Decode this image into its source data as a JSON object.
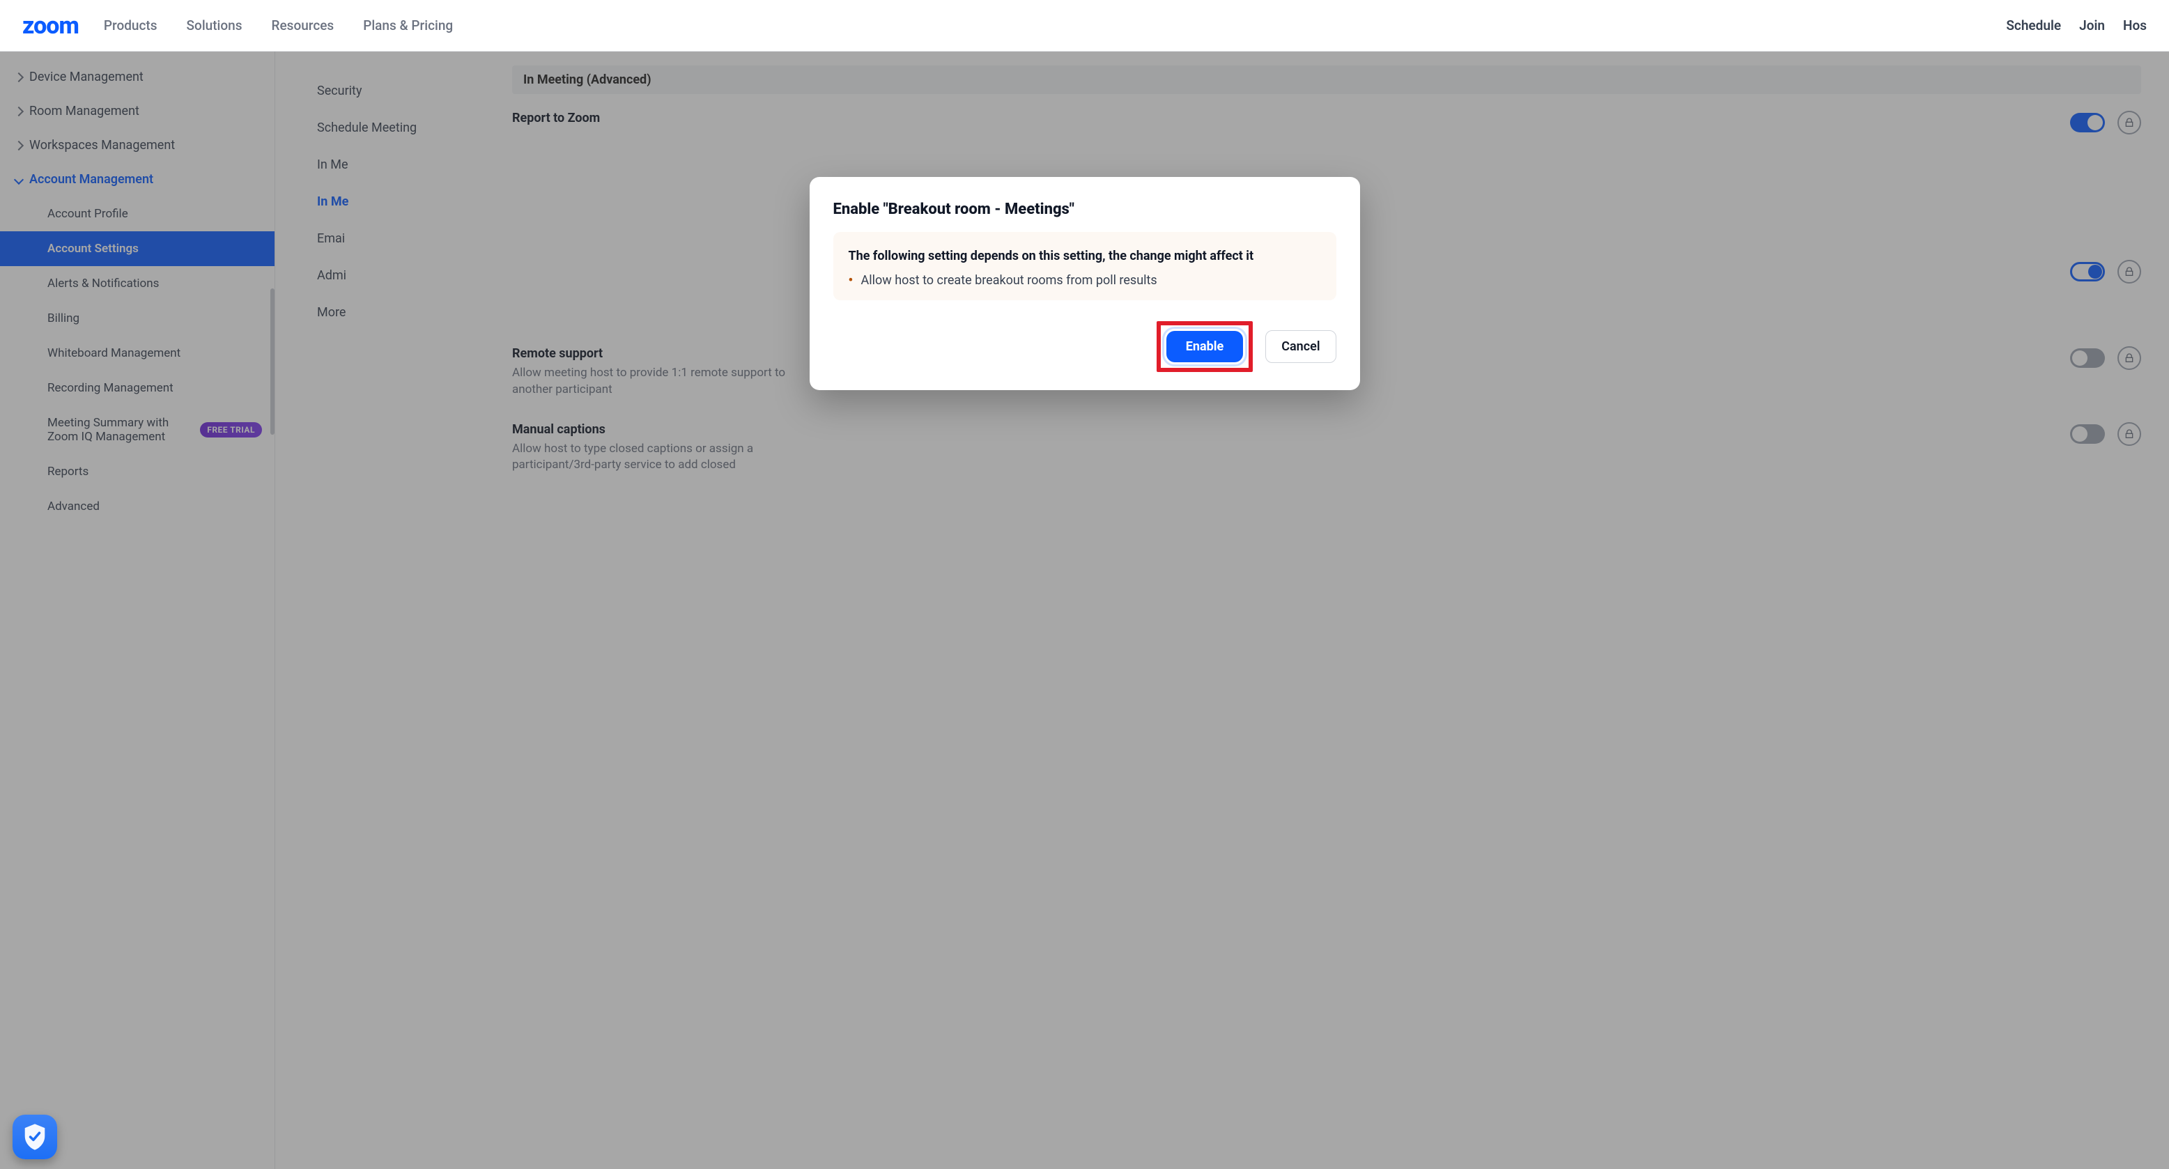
{
  "topnav": {
    "logo": "zoom",
    "menu": [
      "Products",
      "Solutions",
      "Resources",
      "Plans & Pricing"
    ],
    "right": [
      "Schedule",
      "Join",
      "Hos"
    ]
  },
  "sidebar": {
    "items": [
      {
        "label": "Device Management",
        "expanded": false
      },
      {
        "label": "Room Management",
        "expanded": false
      },
      {
        "label": "Workspaces Management",
        "expanded": false
      },
      {
        "label": "Account Management",
        "expanded": true
      }
    ],
    "account_sub": [
      {
        "label": "Account Profile"
      },
      {
        "label": "Account Settings",
        "active": true
      },
      {
        "label": "Alerts & Notifications"
      },
      {
        "label": "Billing"
      },
      {
        "label": "Whiteboard Management"
      },
      {
        "label": "Recording Management"
      },
      {
        "label": "Meeting Summary with Zoom IQ Management",
        "badge": "FREE TRIAL"
      },
      {
        "label": "Reports"
      },
      {
        "label": "Advanced"
      }
    ]
  },
  "settings_tabs": [
    {
      "label": "Security"
    },
    {
      "label": "Schedule Meeting"
    },
    {
      "label": "In Me"
    },
    {
      "label": "In Me",
      "active": true
    },
    {
      "label": "Emai"
    },
    {
      "label": "Admi"
    },
    {
      "label": "More"
    }
  ],
  "content": {
    "section": "In Meeting (Advanced)",
    "rows": [
      {
        "title": "Report to Zoom",
        "desc": "",
        "toggle": "on"
      },
      {
        "title": "",
        "desc": "",
        "toggle": "outline"
      },
      {
        "title": "Remote support",
        "desc": "Allow meeting host to provide 1:1 remote support to another participant",
        "toggle": "off"
      },
      {
        "title": "Manual captions",
        "desc": "Allow host to type closed captions or assign a participant/3rd-party service to add closed",
        "toggle": "off"
      }
    ]
  },
  "modal": {
    "title": "Enable \"Breakout room - Meetings\"",
    "warn": "The following setting depends on this setting, the change might affect it",
    "items": [
      "Allow host to create breakout rooms from poll results"
    ],
    "enable": "Enable",
    "cancel": "Cancel"
  }
}
